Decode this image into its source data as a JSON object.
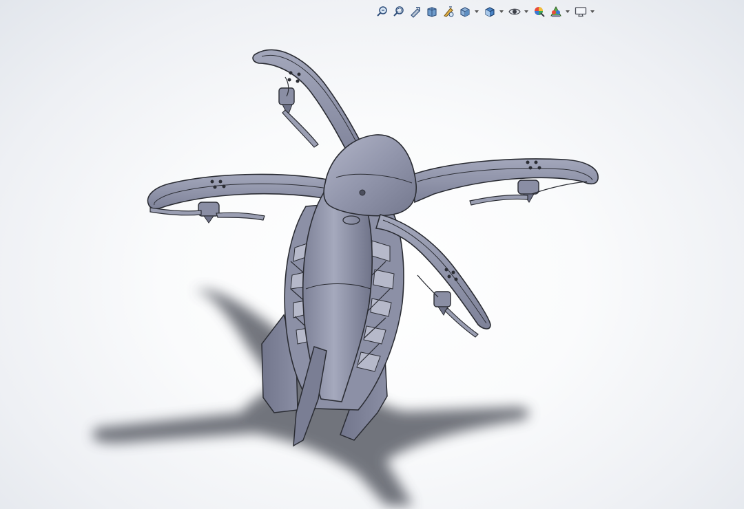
{
  "app": {
    "kind": "3d-cad-viewport"
  },
  "heads_up_toolbar": {
    "buttons": [
      {
        "icon": "zoom-to-fit-icon"
      },
      {
        "icon": "zoom-to-area-icon"
      },
      {
        "icon": "previous-view-icon"
      },
      {
        "icon": "section-view-icon"
      },
      {
        "icon": "dynamic-annotation-icon"
      },
      {
        "icon": "view-orientation-icon",
        "has_dropdown": true
      },
      {
        "icon": "display-style-icon",
        "has_dropdown": true
      },
      {
        "icon": "hide-show-items-icon",
        "has_dropdown": true
      },
      {
        "icon": "edit-appearance-icon"
      },
      {
        "icon": "apply-scene-icon",
        "has_dropdown": true
      },
      {
        "icon": "view-settings-icon",
        "has_dropdown": true
      }
    ]
  },
  "model": {
    "description_icon": "quadcopter-drone-model",
    "body_color": "#8e92a8",
    "edge_color": "#2a2c33",
    "shadow_color": "#5a5d66"
  }
}
